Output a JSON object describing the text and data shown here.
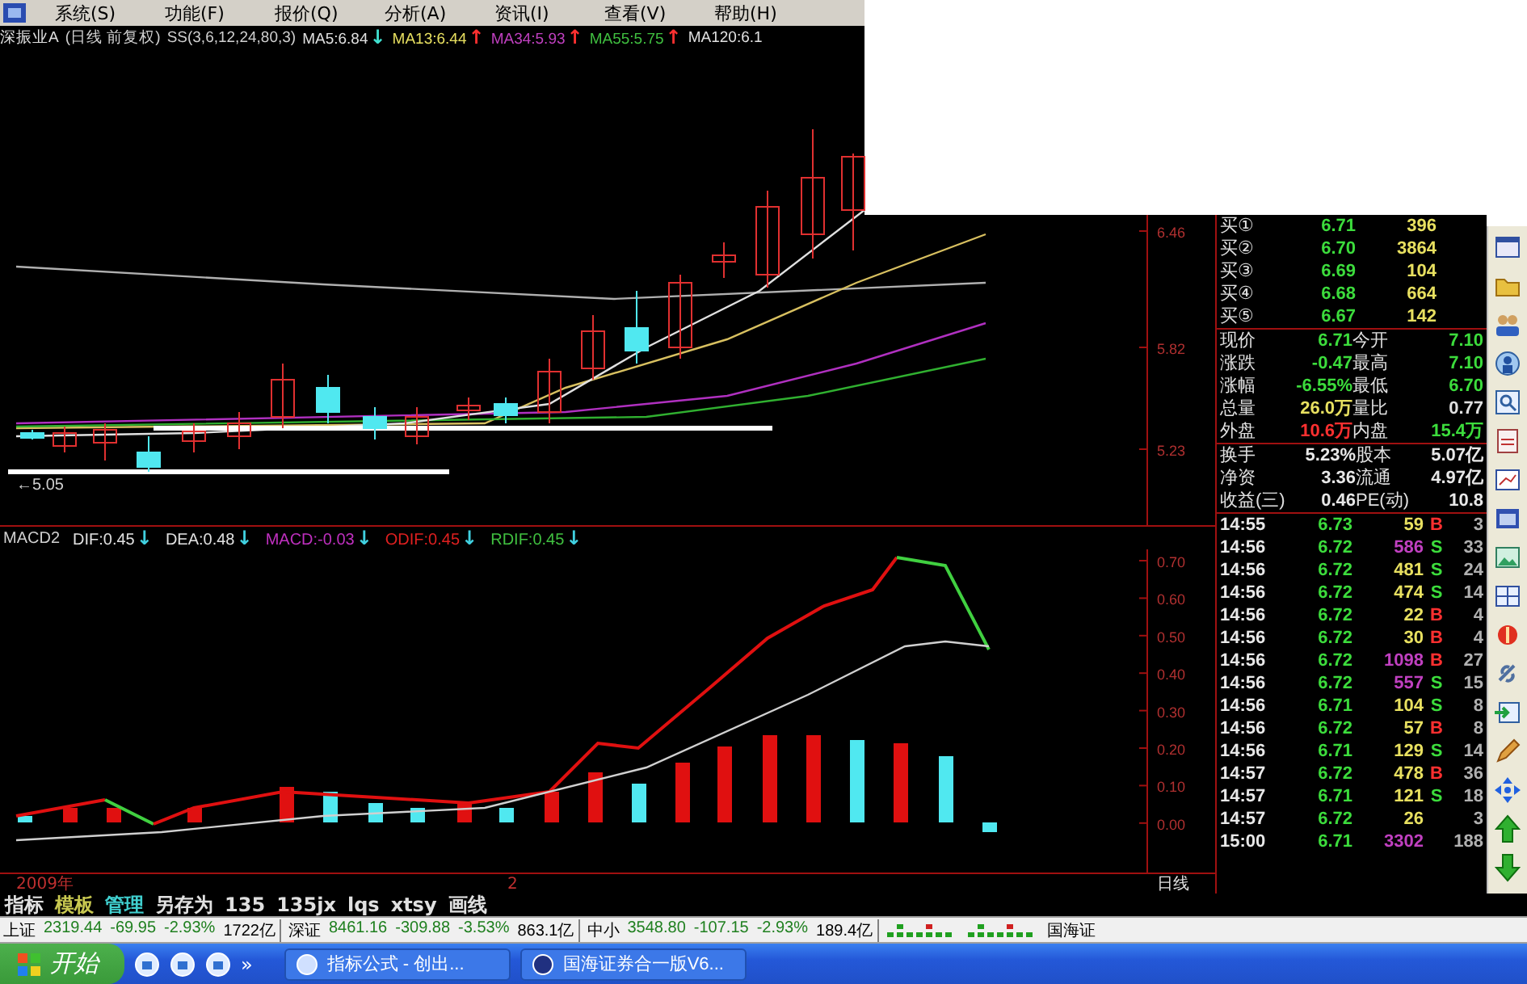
{
  "menu_bar": {
    "items": [
      "系统(S)",
      "功能(F)",
      "报价(Q)",
      "分析(A)",
      "资讯(I)",
      "查看(V)",
      "帮助(H)"
    ]
  },
  "price_chart": {
    "header": {
      "security": "深振业A",
      "period": "(日线 前复权)",
      "indicator": "SS(3,6,12,24,80,3)",
      "averages": [
        {
          "label": "MA5:6.84",
          "arrow": {
            "text": "↓",
            "color": "#40e0d0"
          },
          "color": "#e0e0e0"
        },
        {
          "label": "MA13:6.44",
          "arrow": {
            "text": "↑",
            "color": "#ff3030"
          },
          "color": "#e8e060"
        },
        {
          "label": "MA34:5.93",
          "arrow": {
            "text": "↑",
            "color": "#ff3030"
          },
          "color": "#c040c0"
        },
        {
          "label": "MA55:5.75",
          "arrow": {
            "text": "↑",
            "color": "#ff3030"
          },
          "color": "#40c040"
        },
        {
          "label": "MA120:6.1",
          "color": "#e0e0e0"
        }
      ]
    },
    "axis_labels": [
      "6.46",
      "5.82",
      "5.23"
    ],
    "low_marker": "←5.05"
  },
  "macd_panel": {
    "name": "MACD2",
    "values": [
      {
        "label": "DIF:0.45",
        "arrow": "↓",
        "color": "#e0e0e0"
      },
      {
        "label": "DEA:0.48",
        "arrow": "↓",
        "color": "#e0e0e0"
      },
      {
        "label": "MACD:-0.03",
        "arrow": "↓",
        "color": "#c030c0"
      },
      {
        "label": "ODIF:0.45",
        "arrow": "↓",
        "color": "#e02020"
      },
      {
        "label": "RDIF:0.45",
        "arrow": "↓",
        "color": "#40c040"
      }
    ],
    "axis_labels": [
      "0.70",
      "0.60",
      "0.50",
      "0.40",
      "0.30",
      "0.20",
      "0.10",
      "0.00"
    ]
  },
  "time_axis": {
    "year": "2009年",
    "marker": "2",
    "period": "日线"
  },
  "quote_panel": {
    "bids": [
      {
        "label": "买①",
        "price": "6.71",
        "volume": "396"
      },
      {
        "label": "买②",
        "price": "6.70",
        "volume": "3864"
      },
      {
        "label": "买③",
        "price": "6.69",
        "volume": "104"
      },
      {
        "label": "买④",
        "price": "6.68",
        "volume": "664"
      },
      {
        "label": "买⑤",
        "price": "6.67",
        "volume": "142"
      }
    ],
    "stats": [
      {
        "label": "现价",
        "value": "6.71",
        "color": "#3cdc3c"
      },
      {
        "label": "今开",
        "value": "7.10",
        "color": "#3cdc3c"
      },
      {
        "label": "涨跌",
        "value": "-0.47",
        "color": "#3cdc3c"
      },
      {
        "label": "最高",
        "value": "7.10",
        "color": "#3cdc3c"
      },
      {
        "label": "涨幅",
        "value": "-6.55%",
        "color": "#3cdc3c"
      },
      {
        "label": "最低",
        "value": "6.70",
        "color": "#3cdc3c"
      },
      {
        "label": "总量",
        "value": "26.0万",
        "color": "#e8e060"
      },
      {
        "label": "量比",
        "value": "0.77",
        "color": "#e0e0e0"
      },
      {
        "label": "外盘",
        "value": "10.6万",
        "color": "#ff3030"
      },
      {
        "label": "内盘",
        "value": "15.4万",
        "color": "#3cdc3c"
      }
    ],
    "fundamentals": [
      {
        "label": "换手",
        "value": "5.23%"
      },
      {
        "label": "股本",
        "value": "5.07亿"
      },
      {
        "label": "净资",
        "value": "3.36"
      },
      {
        "label": "流通",
        "value": "4.97亿"
      },
      {
        "label": "收益(三)",
        "value": "0.46"
      },
      {
        "label": "PE(动)",
        "value": "10.8"
      }
    ],
    "trades": [
      {
        "time": "14:55",
        "price": "6.73",
        "volume": "59",
        "side": "B",
        "kind": "buy",
        "count": "3",
        "large": false
      },
      {
        "time": "14:56",
        "price": "6.72",
        "volume": "586",
        "side": "S",
        "kind": "sell",
        "count": "33",
        "large": true
      },
      {
        "time": "14:56",
        "price": "6.72",
        "volume": "481",
        "side": "S",
        "kind": "sell",
        "count": "24",
        "large": false
      },
      {
        "time": "14:56",
        "price": "6.72",
        "volume": "474",
        "side": "S",
        "kind": "sell",
        "count": "14",
        "large": false
      },
      {
        "time": "14:56",
        "price": "6.72",
        "volume": "22",
        "side": "B",
        "kind": "buy",
        "count": "4",
        "large": false
      },
      {
        "time": "14:56",
        "price": "6.72",
        "volume": "30",
        "side": "B",
        "kind": "buy",
        "count": "4",
        "large": false
      },
      {
        "time": "14:56",
        "price": "6.72",
        "volume": "1098",
        "side": "B",
        "kind": "buy",
        "count": "27",
        "large": true
      },
      {
        "time": "14:56",
        "price": "6.72",
        "volume": "557",
        "side": "S",
        "kind": "sell",
        "count": "15",
        "large": true
      },
      {
        "time": "14:56",
        "price": "6.71",
        "volume": "104",
        "side": "S",
        "kind": "sell",
        "count": "8",
        "large": false
      },
      {
        "time": "14:56",
        "price": "6.72",
        "volume": "57",
        "side": "B",
        "kind": "buy",
        "count": "8",
        "large": false
      },
      {
        "time": "14:56",
        "price": "6.71",
        "volume": "129",
        "side": "S",
        "kind": "sell",
        "count": "14",
        "large": false
      },
      {
        "time": "14:57",
        "price": "6.72",
        "volume": "478",
        "side": "B",
        "kind": "buy",
        "count": "36",
        "large": false
      },
      {
        "time": "14:57",
        "price": "6.71",
        "volume": "121",
        "side": "S",
        "kind": "sell",
        "count": "18",
        "large": false
      },
      {
        "time": "14:57",
        "price": "6.72",
        "volume": "26",
        "kind": "none",
        "count": "3",
        "large": false
      },
      {
        "time": "15:00",
        "price": "6.71",
        "volume": "3302",
        "kind": "none",
        "count": "188",
        "large": true
      }
    ]
  },
  "formula_tabs": [
    {
      "label": "指标",
      "color": "#e0e0e0"
    },
    {
      "label": "模板",
      "color": "#c8c850"
    },
    {
      "label": "管理",
      "color": "#40d0d0"
    },
    {
      "label": "另存为",
      "color": "#e0e0e0"
    },
    {
      "label": "135",
      "color": "#e0e0e0"
    },
    {
      "label": "135jx",
      "color": "#e0e0e0"
    },
    {
      "label": "lqs",
      "color": "#e0e0e0"
    },
    {
      "label": "xtsy",
      "color": "#e0e0e0"
    },
    {
      "label": "画线",
      "color": "#e0e0e0"
    }
  ],
  "index_bar": {
    "indices": [
      {
        "name": "上证",
        "value": "2319.44",
        "change": "-69.95",
        "percent": "-2.93%",
        "amount": "1722亿"
      },
      {
        "name": "深证",
        "value": "8461.16",
        "change": "-309.88",
        "percent": "-3.53%",
        "amount": "863.1亿"
      },
      {
        "name": "中小",
        "value": "3548.80",
        "change": "-107.15",
        "percent": "-2.93%",
        "amount": "189.4亿"
      }
    ],
    "broker": "国海证"
  },
  "taskbar": {
    "start": "开始",
    "chevron": "»",
    "tasks": [
      "指标公式 - 创出...",
      "国海证券合一版V6..."
    ]
  }
}
